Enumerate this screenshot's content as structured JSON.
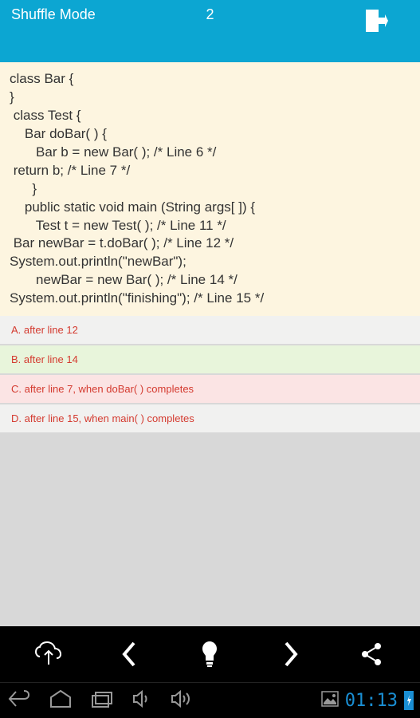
{
  "header": {
    "title": "Shuffle Mode",
    "number": "2"
  },
  "code_lines": [
    "class Bar {",
    "}",
    " class Test {",
    "    Bar doBar( ) {",
    "       Bar b = new Bar( ); /* Line 6 */",
    " return b; /* Line 7 */",
    "      }",
    "    public static void main (String args[ ]) {",
    "       Test t = new Test( ); /* Line 11 */",
    " Bar newBar = t.doBar( ); /* Line 12 */",
    "System.out.println(\"newBar\");",
    "       newBar = new Bar( ); /* Line 14 */",
    "System.out.println(\"finishing\"); /* Line 15 */"
  ],
  "answers": {
    "a": "A. after line 12",
    "b": "B. after line 14",
    "c": "C. after line 7, when doBar( ) completes",
    "d": "D. after line 15, when main( ) completes"
  },
  "status": {
    "time": "01:13"
  }
}
